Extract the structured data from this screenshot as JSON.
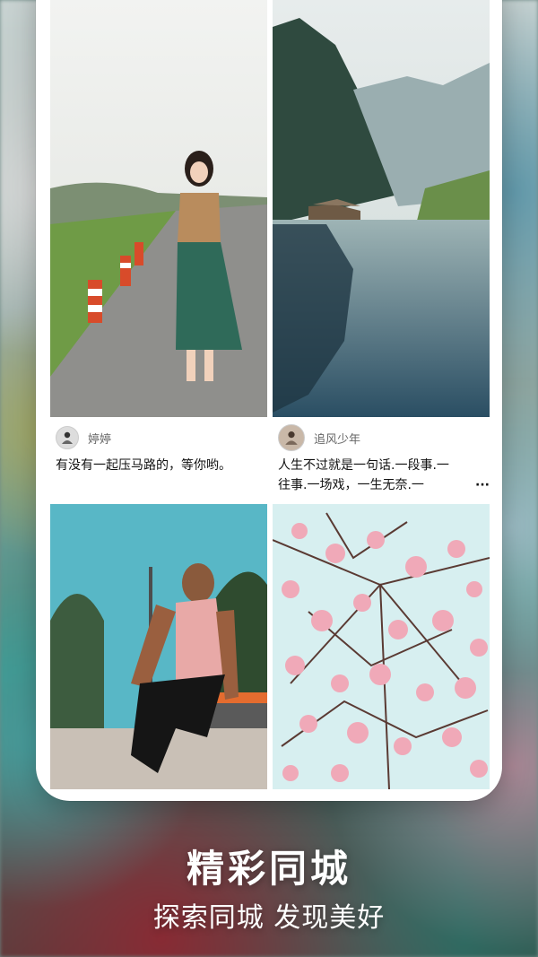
{
  "feed": {
    "posts": [
      {
        "author": "婷婷",
        "caption": "有没有一起压马路的，等你哟。",
        "image_icon": "photo-woman-walking"
      },
      {
        "author": "追风少年",
        "caption_lines": [
          "人生不过就是一句话.一段事.一",
          "往事.一场戏，一生无奈.一"
        ],
        "more": "···",
        "image_icon": "photo-mountain-lake"
      },
      {
        "image_icon": "photo-man-skater"
      },
      {
        "image_icon": "photo-cherry-blossom"
      }
    ]
  },
  "promo": {
    "title": "精彩同城",
    "subtitle": "探索同城 发现美好"
  }
}
